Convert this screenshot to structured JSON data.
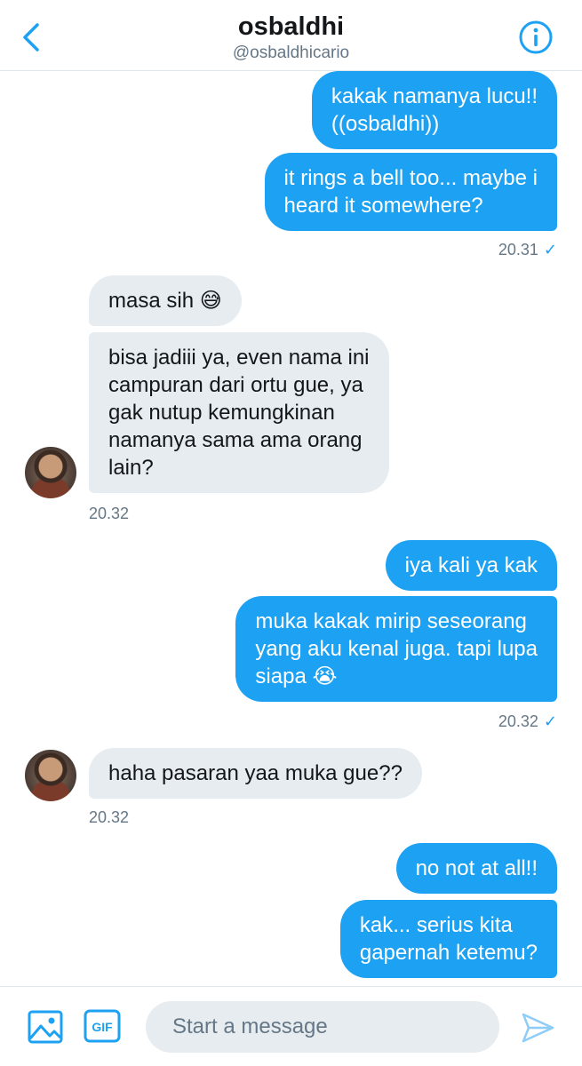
{
  "header": {
    "name": "osbaldhi",
    "handle": "@osbaldhicario",
    "back_icon": "chevron-left-icon",
    "info_icon": "info-icon"
  },
  "messages": [
    {
      "side": "out",
      "text_lines": [
        "kakak namanya lucu!!",
        "((osbaldhi))"
      ]
    },
    {
      "side": "out",
      "text_lines": [
        "it rings a bell too... maybe i",
        "heard it somewhere?"
      ]
    },
    {
      "side": "out_time",
      "time": "20.31",
      "status": "✓"
    },
    {
      "side": "in",
      "text": "masa sih",
      "emoji": "😅"
    },
    {
      "side": "in",
      "text_lines": [
        "bisa jadiii ya, even nama ini",
        "campuran dari ortu gue, ya",
        "gak nutup kemungkinan",
        "namanya sama ama orang",
        "lain?"
      ]
    },
    {
      "side": "in_time",
      "time": "20.32"
    },
    {
      "side": "out",
      "text": "iya kali ya kak"
    },
    {
      "side": "out",
      "text_lines": [
        "muka kakak mirip seseorang",
        "yang aku kenal juga. tapi lupa",
        "siapa"
      ],
      "emoji": "😭"
    },
    {
      "side": "out_time",
      "time": "20.32",
      "status": "✓"
    },
    {
      "side": "in",
      "text": "haha pasaran yaa muka gue??"
    },
    {
      "side": "in_time",
      "time": "20.32"
    },
    {
      "side": "out",
      "text": "no not at all!!"
    },
    {
      "side": "out",
      "text_lines": [
        "kak... serius kita",
        "gapernah ketemu?"
      ]
    }
  ],
  "composer": {
    "placeholder": "Start a message",
    "gif_label": "GIF",
    "media_icon": "image-icon",
    "send_icon": "send-icon"
  },
  "colors": {
    "accent": "#1da1f2",
    "incoming_bubble": "#e6ecf0",
    "secondary_text": "#657786"
  }
}
